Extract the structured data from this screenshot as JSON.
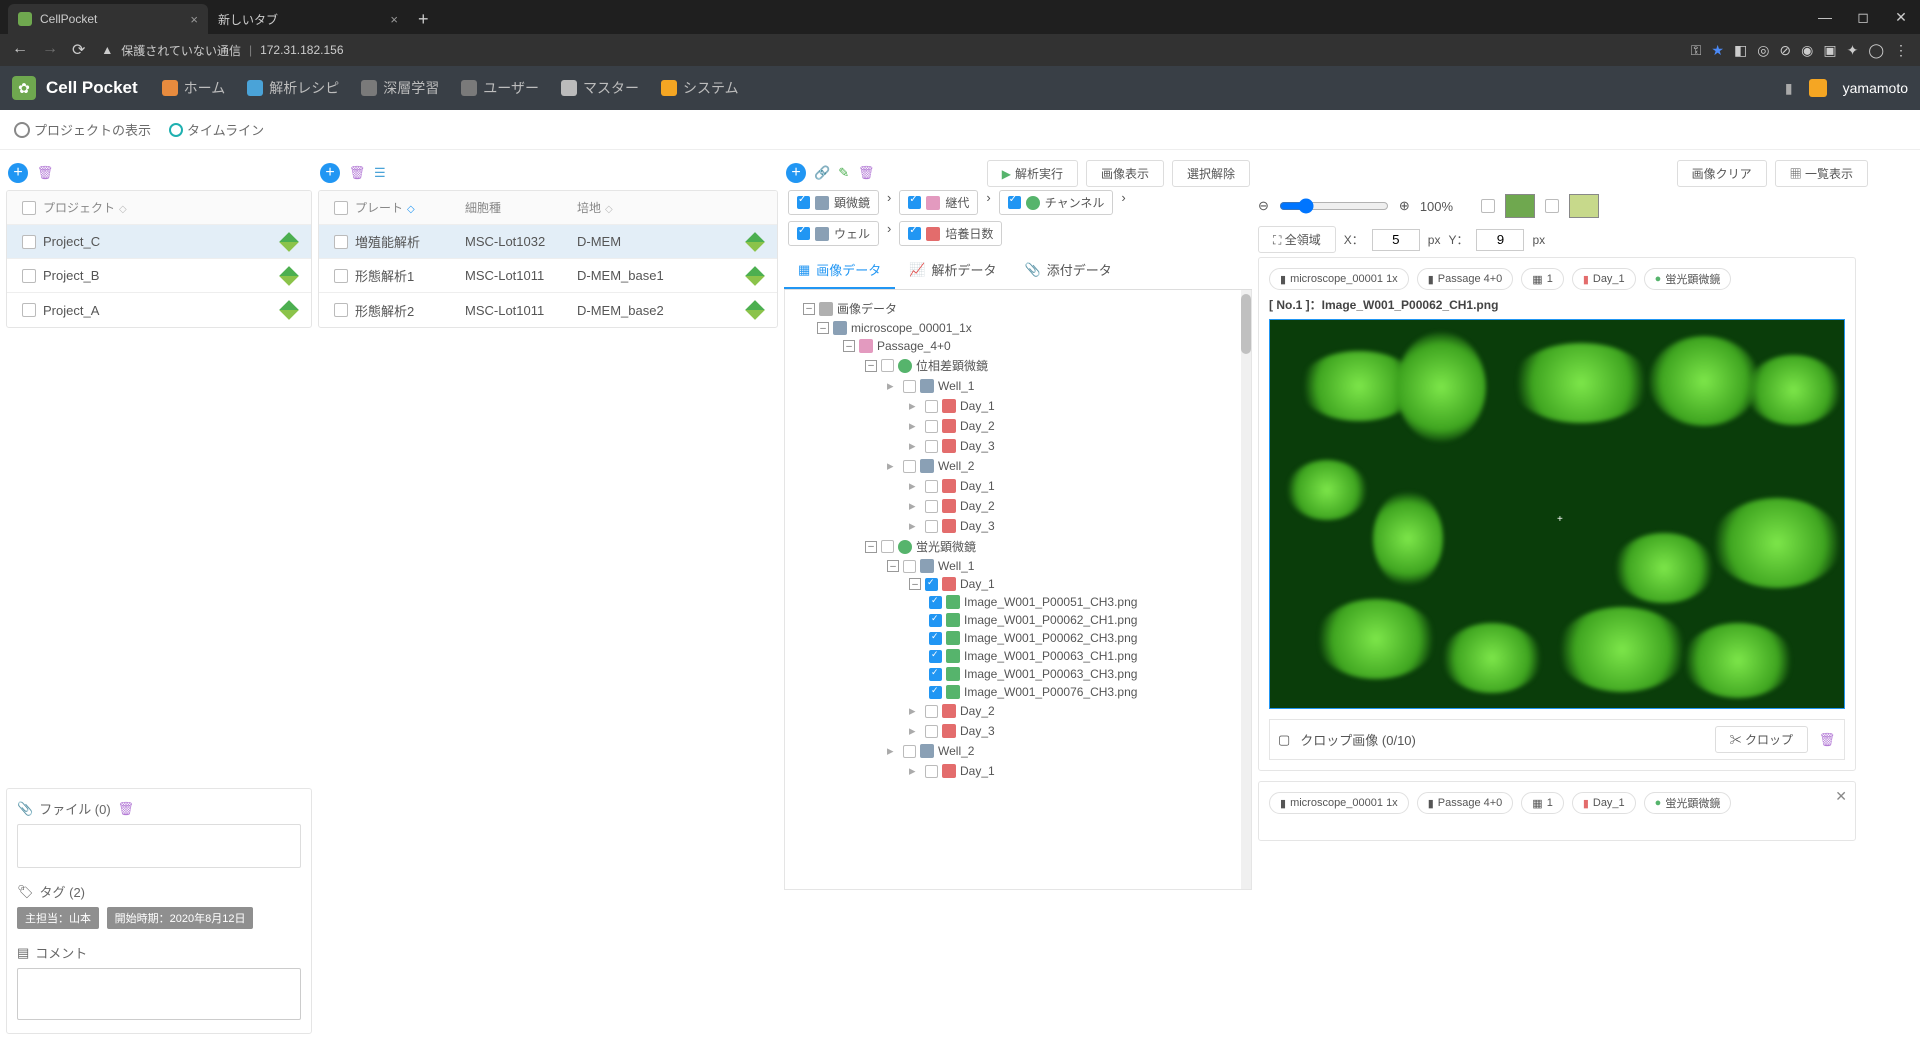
{
  "browser": {
    "tabs": [
      {
        "title": "CellPocket",
        "active": true
      },
      {
        "title": "新しいタブ",
        "active": false
      }
    ],
    "insecure_label": "保護されていない通信",
    "url": "172.31.182.156"
  },
  "app": {
    "title": "Cell Pocket",
    "nav": [
      {
        "label": "ホーム",
        "color": "#e88b3e"
      },
      {
        "label": "解析レシピ",
        "color": "#4aa3d8"
      },
      {
        "label": "深層学習",
        "color": "#8a5cc2"
      },
      {
        "label": "ユーザー",
        "color": "#888"
      },
      {
        "label": "マスター",
        "color": "#888"
      },
      {
        "label": "システム",
        "color": "#f5a623"
      }
    ],
    "user": "yamamoto"
  },
  "subbar": {
    "view": "プロジェクトの表示",
    "timeline": "タイムライン"
  },
  "projects": {
    "header": "プロジェクト",
    "rows": [
      {
        "name": "Project_C",
        "sel": true
      },
      {
        "name": "Project_B",
        "sel": false
      },
      {
        "name": "Project_A",
        "sel": false
      }
    ]
  },
  "plates": {
    "headers": {
      "plate": "プレート",
      "cell": "細胞種",
      "medium": "培地"
    },
    "rows": [
      {
        "plate": "増殖能解析",
        "cell": "MSC-Lot1032",
        "medium": "D-MEM",
        "sel": true
      },
      {
        "plate": "形態解析1",
        "cell": "MSC-Lot1011",
        "medium": "D-MEM_base1",
        "sel": false
      },
      {
        "plate": "形態解析2",
        "cell": "MSC-Lot1011",
        "medium": "D-MEM_base2",
        "sel": false
      }
    ]
  },
  "filebox": {
    "title": "ファイル (0)"
  },
  "tagbox": {
    "title": "タグ (2)",
    "tags": [
      "主担当：山本",
      "開始時期：2020年8月12日"
    ]
  },
  "commentbox": {
    "title": "コメント"
  },
  "center_toolbar": {
    "run": "解析実行",
    "imgshow": "画像表示",
    "unselect": "選択解除"
  },
  "filters": {
    "microscope": "顕微鏡",
    "passage": "継代",
    "channel": "チャンネル",
    "well": "ウェル",
    "days": "培養日数"
  },
  "tabs3": {
    "image": "画像データ",
    "analysis": "解析データ",
    "attach": "添付データ"
  },
  "tree": {
    "root": "画像データ",
    "microscope": "microscope_00001_1x",
    "passage": "Passage_4+0",
    "phase": "位相差顕微鏡",
    "fluor": "蛍光顕微鏡",
    "wells": {
      "w1": "Well_1",
      "w2": "Well_2"
    },
    "days": {
      "d1": "Day_1",
      "d2": "Day_2",
      "d3": "Day_3"
    },
    "images": [
      "Image_W001_P00051_CH3.png",
      "Image_W001_P00062_CH1.png",
      "Image_W001_P00062_CH3.png",
      "Image_W001_P00063_CH1.png",
      "Image_W001_P00063_CH3.png",
      "Image_W001_P00076_CH3.png"
    ]
  },
  "right_toolbar": {
    "clear": "画像クリア",
    "list": "一覧表示"
  },
  "viewer": {
    "zoom": "100%",
    "fullarea": "全領域",
    "x_label": "X：",
    "x": "5",
    "px": "px",
    "y_label": "Y：",
    "y": "9",
    "meta": {
      "scope": "microscope_00001 1x",
      "passage": "Passage 4+0",
      "n": "1",
      "day": "Day_1",
      "ch": "蛍光顕微鏡"
    },
    "title": "[ No.1 ]：Image_W001_P00062_CH1.png",
    "crop_title": "クロップ画像 (0/10)",
    "crop_btn": "クロップ"
  }
}
